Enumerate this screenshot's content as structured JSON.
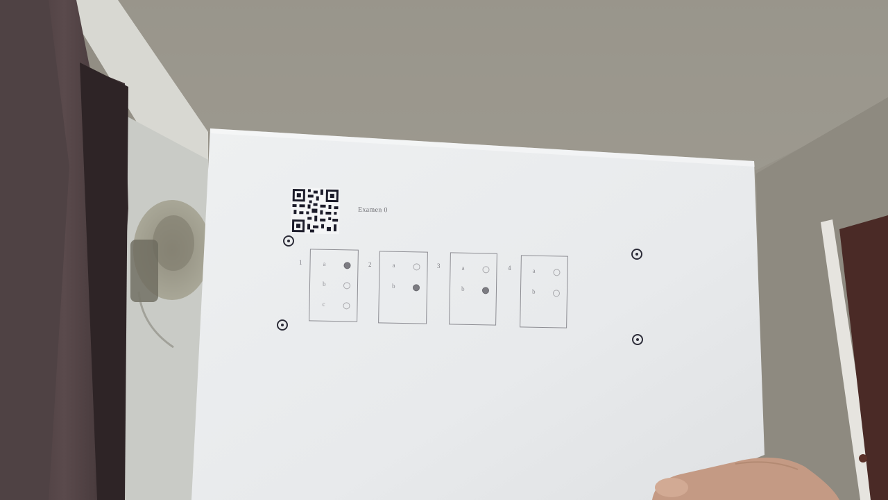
{
  "sheet": {
    "exam_label": "Examen 0",
    "questions": [
      {
        "number": "1",
        "options": [
          {
            "letter": "a",
            "filled": true
          },
          {
            "letter": "b",
            "filled": false
          },
          {
            "letter": "c",
            "filled": false
          }
        ]
      },
      {
        "number": "2",
        "options": [
          {
            "letter": "a",
            "filled": false
          },
          {
            "letter": "b",
            "filled": true
          }
        ]
      },
      {
        "number": "3",
        "options": [
          {
            "letter": "a",
            "filled": false
          },
          {
            "letter": "b",
            "filled": true
          }
        ]
      },
      {
        "number": "4",
        "options": [
          {
            "letter": "a",
            "filled": false
          },
          {
            "letter": "b",
            "filled": false
          }
        ]
      }
    ]
  },
  "colors": {
    "wall": "#8e8a80",
    "ceiling": "#9a968c",
    "paper": "#e9ebed",
    "curtain": "#4a3c3e",
    "ink": "#2c2c38"
  }
}
